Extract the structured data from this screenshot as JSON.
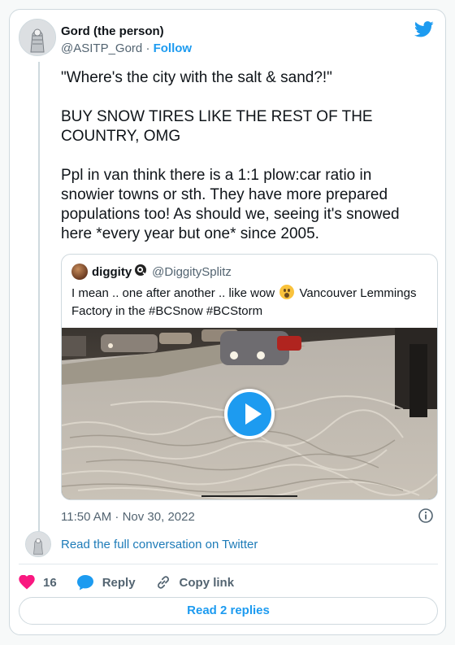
{
  "author": {
    "name": "Gord (the person)",
    "handle": "@ASITP_Gord",
    "separator": "·",
    "follow_label": "Follow"
  },
  "tweet": {
    "text": "\"Where's the city with the salt & sand?!\"\n\nBUY SNOW TIRES LIKE THE REST OF THE COUNTRY, OMG\n\nPpl in van think there is a 1:1 plow:car ratio in snowier towns or sth. They have more prepared populations too! As should we, seeing it's snowed here *every year but one* since 2005.",
    "timestamp": "11:50 AM · Nov 30, 2022"
  },
  "quote": {
    "name": "diggity",
    "handle": "@DiggitySplitz",
    "text_before_emoji": "I mean .. one after another .. like wow",
    "emoji": "astonished-face",
    "text_after_emoji": "Vancouver Lemmings Factory in the #BCSnow #BCStorm",
    "video_progress": 0.0
  },
  "footer": {
    "read_conversation": "Read the full conversation on Twitter",
    "like_count": "16",
    "reply_label": "Reply",
    "copy_link_label": "Copy link",
    "read_replies_label": "Read 2 replies"
  },
  "icons": [
    "twitter-bird-icon",
    "info-icon",
    "heart-icon",
    "reply-icon",
    "link-icon",
    "play-icon"
  ],
  "colors": {
    "accent": "#1d9bf0",
    "like": "#f91880",
    "link": "#1d7bb8",
    "secondary_text": "#536471",
    "border": "#cfd9de"
  }
}
